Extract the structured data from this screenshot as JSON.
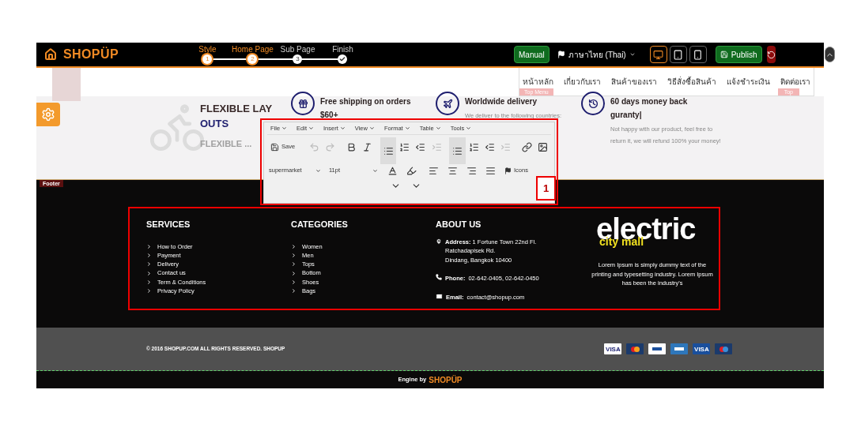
{
  "topbar": {
    "logo": "SHOPÜP",
    "steps": [
      {
        "label": "Style",
        "marker": "1",
        "kind": "number",
        "reached": true
      },
      {
        "label": "Home Page",
        "marker": "2",
        "kind": "number",
        "reached": true
      },
      {
        "label": "Sub Page",
        "marker": "3",
        "kind": "number",
        "reached": false
      },
      {
        "label": "Finish",
        "kind": "check",
        "reached": false
      }
    ],
    "manual": "Manual",
    "language": "ภาษาไทย (Thai)",
    "devices": [
      {
        "kind": "desktop",
        "selected": true
      },
      {
        "kind": "tablet",
        "selected": false
      },
      {
        "kind": "phone",
        "selected": false
      }
    ],
    "publish": "Publish"
  },
  "header": {
    "menu": [
      "หน้าหลัก",
      "เกี่ยวกับเรา",
      "สินค้าของเรา",
      "วิธีสั่งซื้อสินค้า",
      "แจ้งชำระเงิน",
      "ติดต่อเรา"
    ],
    "menu_tag": "Top Menu",
    "right_tag": "Top"
  },
  "features": {
    "title_1": "FLEXIBLE LAY",
    "title_2": "OUTS",
    "subtitle": "FLEXIBLE ...",
    "items": [
      {
        "kind": "gift",
        "title": "Free shipping on orders",
        "title_2": "$60+"
      },
      {
        "kind": "plane",
        "title": "Worldwide delivery",
        "text": "We deliver to the following countries:"
      },
      {
        "kind": "history",
        "title": "60 days money back",
        "title_2": "guranty|",
        "text": "Not happy with our product, feel free to return it, we will refund 100% your money!"
      }
    ]
  },
  "editor": {
    "menus": [
      "File",
      "Edit",
      "Insert",
      "View",
      "Format",
      "Table",
      "Tools"
    ],
    "save": "Save",
    "font": "supermarket",
    "size": "11pt",
    "icons": "Icons",
    "annotation": "1"
  },
  "footer": {
    "tag": "Footer",
    "columns": [
      {
        "title": "SERVICES",
        "links": [
          "How to Order",
          "Payment",
          "Delivery",
          "Contact us",
          "Term & Conditions",
          "Privacy Policy"
        ]
      },
      {
        "title": "CATEGORIES",
        "links": [
          "Women",
          "Men",
          "Tops",
          "Bottom",
          "Shoes",
          "Bags"
        ]
      }
    ],
    "about": {
      "title": "ABOUT US",
      "address_label": "Address:",
      "address": [
        "1 Fortune Town 22nd Fl.",
        "Ratchadapisek Rd.",
        "Dindang, Bangkok 10400"
      ],
      "phone_label": "Phone:",
      "phone": "02-642-0405, 02-642-0450",
      "email_label": "Email:",
      "email": "contact@shopup.com"
    },
    "brand": {
      "word_1": "electric",
      "word_2": "city mall",
      "text": "Lorem Ipsum is simply dummy text of the printing and typesetting industry. Lorem Ipsum has been the industry's"
    }
  },
  "copyright": {
    "text": "© 2016 SHOPUP.COM ALL RIGHTS RESERVED. SHOPUP",
    "cards": [
      {
        "kind": "visa",
        "label": "VISA"
      },
      {
        "kind": "mastercard"
      },
      {
        "kind": "paypal"
      },
      {
        "kind": "amex"
      },
      {
        "kind": "visa-electron",
        "label": "VISA"
      },
      {
        "kind": "maestro"
      }
    ]
  },
  "engine": {
    "text": "Engine by",
    "brand": "SHOPÜP"
  }
}
